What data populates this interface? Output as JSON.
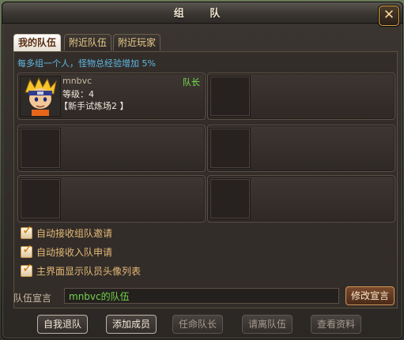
{
  "window": {
    "title": "组 队"
  },
  "tabs": [
    "我的队伍",
    "附近队伍",
    "附近玩家"
  ],
  "bonus_text": "每多组一个人，怪物总经验增加 5%",
  "slots": [
    {
      "name": "mnbvc",
      "level": "等级：4",
      "location": "【新手试炼场2 】",
      "role": "队长"
    }
  ],
  "checkboxes": [
    {
      "label": "自动接收组队邀请",
      "checked": true
    },
    {
      "label": "自动接收入队申请",
      "checked": true
    },
    {
      "label": "主界面显示队员头像列表",
      "checked": true
    }
  ],
  "motto": {
    "label": "队伍宣言",
    "value": "mnbvc的队伍",
    "button": "修改宣言"
  },
  "buttons": [
    "自我退队",
    "添加成员",
    "任命队长",
    "请离队伍",
    "查看资料"
  ],
  "colors": {
    "accent": "#e5b976",
    "role": "#76e24c",
    "info": "#5fb9e5"
  }
}
